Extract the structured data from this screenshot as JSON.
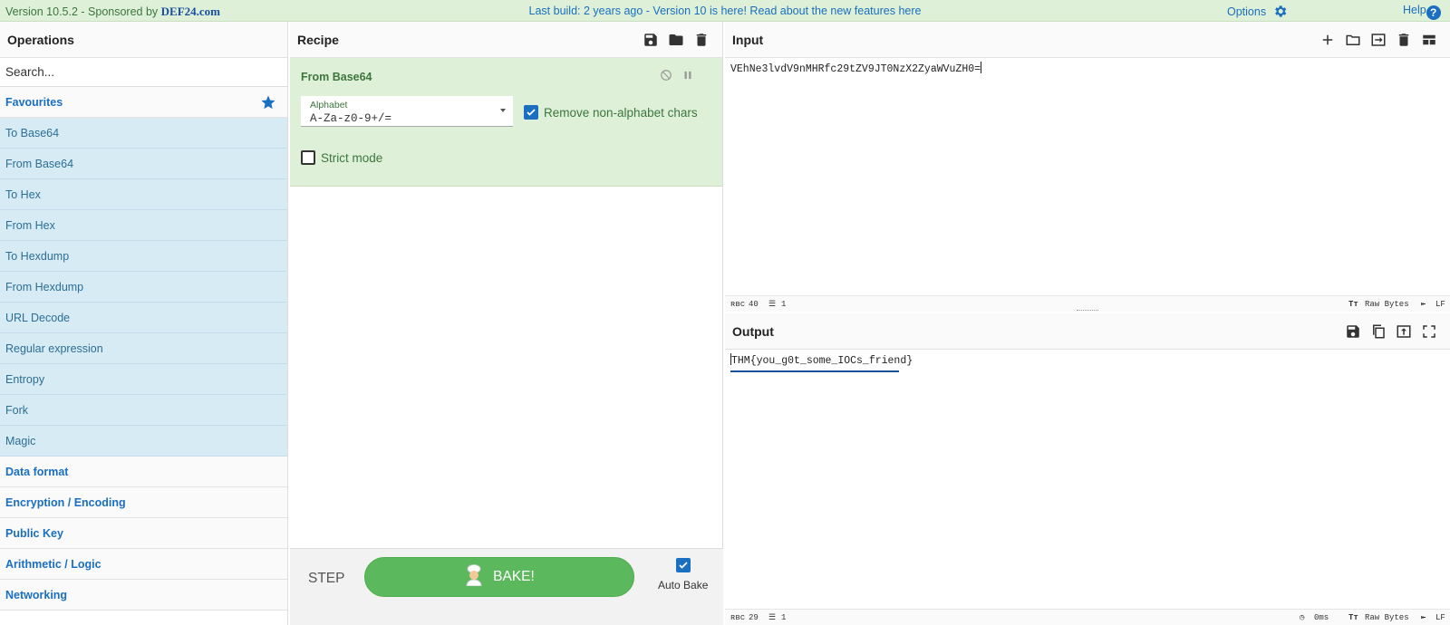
{
  "banner": {
    "version": "Version 10.5.2 - Sponsored by ",
    "sponsor": "DEF24.com",
    "build_notice": "Last build: 2 years ago - Version 10 is here! Read about the new features ",
    "build_link": "here",
    "options": "Options",
    "help": "Help"
  },
  "operations": {
    "title": "Operations",
    "search_placeholder": "Search...",
    "favourites": "Favourites",
    "items": [
      "To Base64",
      "From Base64",
      "To Hex",
      "From Hex",
      "To Hexdump",
      "From Hexdump",
      "URL Decode",
      "Regular expression",
      "Entropy",
      "Fork",
      "Magic"
    ],
    "categories": [
      "Data format",
      "Encryption / Encoding",
      "Public Key",
      "Arithmetic / Logic",
      "Networking"
    ]
  },
  "recipe": {
    "title": "Recipe",
    "operation": {
      "name": "From Base64",
      "alphabet_label": "Alphabet",
      "alphabet_value": "A-Za-z0-9+/=",
      "remove_nonalpha_label": "Remove non-alphabet chars",
      "remove_nonalpha_checked": true,
      "strict_label": "Strict mode",
      "strict_checked": false
    },
    "step_label": "STEP",
    "bake_label": "BAKE!",
    "auto_bake_label": "Auto Bake",
    "auto_bake_checked": true
  },
  "input": {
    "title": "Input",
    "value": "VEhNe3lvdV9nMHRfc29tZV9JT0NzX2ZyaWVuZH0=",
    "length": "40",
    "lines": "1",
    "encoding": "Raw Bytes",
    "eol": "LF"
  },
  "output": {
    "title": "Output",
    "value": "THM{you_g0t_some_IOCs_friend}",
    "length": "29",
    "lines": "1",
    "time": "0ms",
    "encoding": "Raw Bytes",
    "eol": "LF"
  },
  "colors": {
    "banner_bg": "#dff0d8",
    "accent_blue": "#1a6fc0",
    "favourite_bg": "#d7ebf5",
    "bake_green": "#5cb85c"
  }
}
